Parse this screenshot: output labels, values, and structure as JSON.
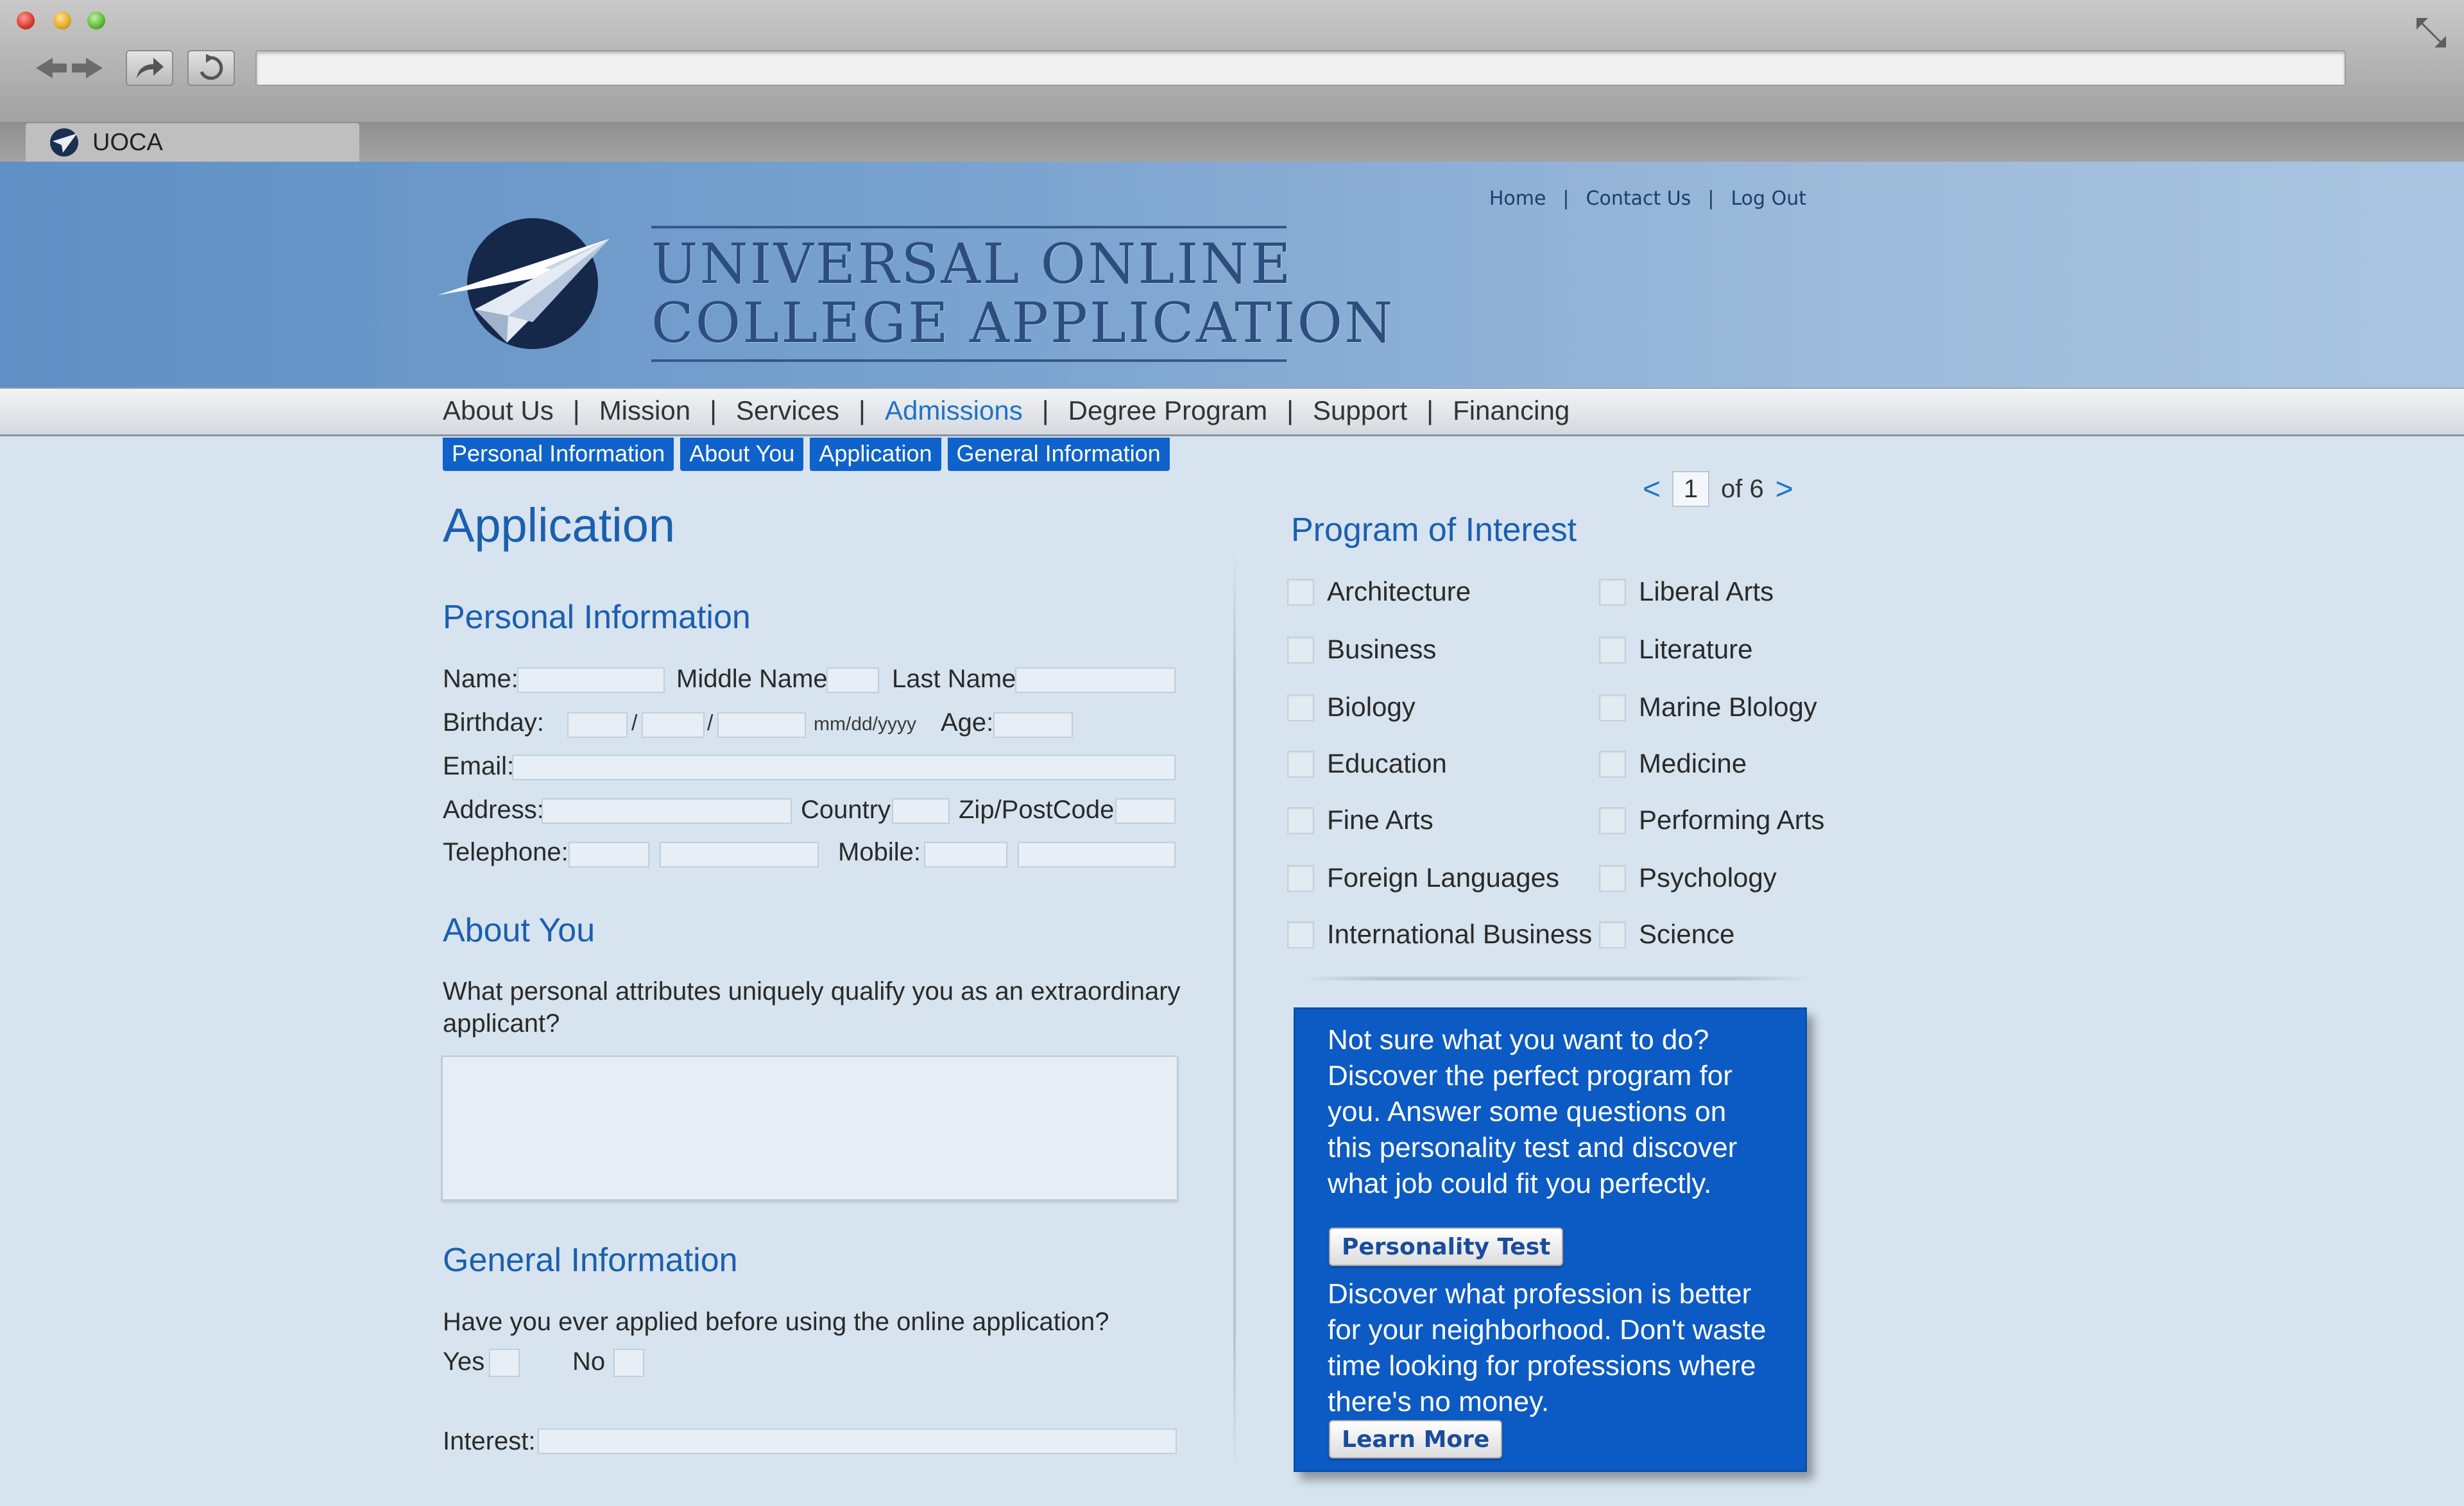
{
  "browser": {
    "tab_title": "UOCA",
    "url": ""
  },
  "header": {
    "logo_line1": "UNIVERSAL ONLINE",
    "logo_line2": "COLLEGE APPLICATION",
    "top_links": [
      "Home",
      "|",
      "Contact Us",
      "|",
      "Log Out"
    ]
  },
  "nav": {
    "items": [
      "About Us",
      "Mission",
      "Services",
      "Admissions",
      "Degree Program",
      "Support",
      "Financing"
    ],
    "active": "Admissions"
  },
  "sub_tabs": [
    "Personal Information",
    "About You",
    "Application",
    "General Information"
  ],
  "pagination": {
    "prev": "<",
    "current": "1",
    "of_label": "of 6",
    "next": ">"
  },
  "form": {
    "page_title": "Application",
    "personal": {
      "title": "Personal Information",
      "name_label": "Name:",
      "middle_label": "Middle Name:",
      "last_label": "Last Name:",
      "birthday_label": "Birthday:",
      "date_sep": "/",
      "date_hint": "mm/dd/yyyy",
      "age_label": "Age:",
      "email_label": "Email:",
      "address_label": "Address:",
      "country_label": "Country:",
      "zip_label": "Zip/PostCode:",
      "telephone_label": "Telephone:",
      "mobile_label": "Mobile:"
    },
    "about": {
      "title": "About You",
      "question": "What personal attributes uniquely qualify you as an extraordinary applicant?"
    },
    "general": {
      "title": "General Information",
      "question": "Have you ever applied before using the online application?",
      "yes_label": "Yes",
      "no_label": "No",
      "interest_label": "Interest:"
    }
  },
  "programs": {
    "title": "Program of Interest",
    "left": [
      "Architecture",
      "Business",
      "Biology",
      "Education",
      "Fine Arts",
      "Foreign Languages",
      "International Business"
    ],
    "right": [
      "Liberal Arts",
      "Literature",
      "Marine Blology",
      "Medicine",
      "Performing Arts",
      "Psychology",
      "Science"
    ]
  },
  "promo": {
    "text1": "Not sure what you want to do? Discover the perfect program for you. Answer some questions on this personality test and discover what job could fit you perfectly.",
    "button1": "Personality Test",
    "text2": "Discover what profession is better for your neighborhood. Don't waste time looking for professions where there's no money.",
    "button2": "Learn More"
  },
  "colors": {
    "accent": "#1a5fb0",
    "subtab_blue": "#0f62c9",
    "promo_blue": "#0c5ac4",
    "page_bg": "#d7e3ee"
  }
}
